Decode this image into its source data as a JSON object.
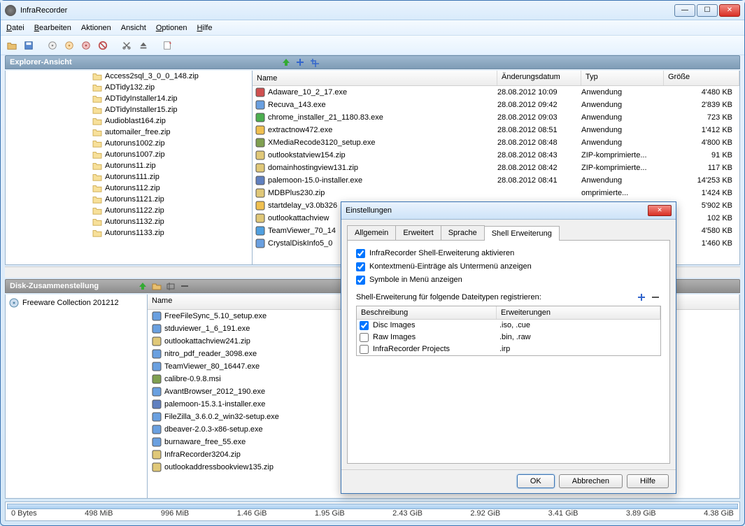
{
  "app": {
    "title": "InfraRecorder"
  },
  "menu": {
    "file": "Datei",
    "edit": "Bearbeiten",
    "actions": "Aktionen",
    "view": "Ansicht",
    "options": "Optionen",
    "help": "Hilfe"
  },
  "panes": {
    "explorer_title": "Explorer-Ansicht",
    "disk_title": "Disk-Zusammenstellung"
  },
  "tree": [
    "Access2sql_3_0_0_148.zip",
    "ADTidy132.zip",
    "ADTidyInstaller14.zip",
    "ADTidyInstaller15.zip",
    "Audioblast164.zip",
    "automailer_free.zip",
    "Autoruns1002.zip",
    "Autoruns1007.zip",
    "Autoruns11.zip",
    "Autoruns111.zip",
    "Autoruns112.zip",
    "Autoruns1121.zip",
    "Autoruns1122.zip",
    "Autoruns1132.zip",
    "Autoruns1133.zip"
  ],
  "file_cols": {
    "name": "Name",
    "date": "Änderungsdatum",
    "type": "Typ",
    "size": "Größe"
  },
  "files": [
    {
      "icon": "app-red",
      "name": "Adaware_10_2_17.exe",
      "date": "28.08.2012 10:09",
      "type": "Anwendung",
      "size": "4'480 KB"
    },
    {
      "icon": "app",
      "name": "Recuva_143.exe",
      "date": "28.08.2012 09:42",
      "type": "Anwendung",
      "size": "2'839 KB"
    },
    {
      "icon": "chrome",
      "name": "chrome_installer_21_1180.83.exe",
      "date": "28.08.2012 09:03",
      "type": "Anwendung",
      "size": "723 KB"
    },
    {
      "icon": "clock",
      "name": "extractnow472.exe",
      "date": "28.08.2012 08:51",
      "type": "Anwendung",
      "size": "1'412 KB"
    },
    {
      "icon": "installer",
      "name": "XMediaRecode3120_setup.exe",
      "date": "28.08.2012 08:48",
      "type": "Anwendung",
      "size": "4'800 KB"
    },
    {
      "icon": "zip",
      "name": "outlookstatview154.zip",
      "date": "28.08.2012 08:43",
      "type": "ZIP-komprimierte...",
      "size": "91 KB"
    },
    {
      "icon": "zip",
      "name": "domainhostingview131.zip",
      "date": "28.08.2012 08:42",
      "type": "ZIP-komprimierte...",
      "size": "117 KB"
    },
    {
      "icon": "moon",
      "name": "palemoon-15.0-installer.exe",
      "date": "28.08.2012 08:41",
      "type": "Anwendung",
      "size": "14'253 KB"
    },
    {
      "icon": "zip",
      "name": "MDBPlus230.zip",
      "date": "",
      "type": "omprimierte...",
      "size": "1'424 KB"
    },
    {
      "icon": "clock",
      "name": "startdelay_v3.0b326",
      "date": "",
      "type": "ndung",
      "size": "5'902 KB"
    },
    {
      "icon": "zip",
      "name": "outlookattachview",
      "date": "",
      "type": "omprimierte...",
      "size": "102 KB"
    },
    {
      "icon": "tv",
      "name": "TeamViewer_70_14",
      "date": "",
      "type": "ndung",
      "size": "4'580 KB"
    },
    {
      "icon": "app",
      "name": "CrystalDiskInfo5_0",
      "date": "",
      "type": "omprimierte...",
      "size": "1'460 KB"
    }
  ],
  "disk_root": "Freeware Collection 201212",
  "disk_col_name": "Name",
  "disk_files": [
    {
      "icon": "app",
      "name": "FreeFileSync_5.10_setup.exe"
    },
    {
      "icon": "app",
      "name": "stduviewer_1_6_191.exe"
    },
    {
      "icon": "zip",
      "name": "outlookattachview241.zip"
    },
    {
      "icon": "app",
      "name": "nitro_pdf_reader_3098.exe"
    },
    {
      "icon": "app",
      "name": "TeamViewer_80_16447.exe"
    },
    {
      "icon": "installer",
      "name": "calibre-0.9.8.msi"
    },
    {
      "icon": "app",
      "name": "AvantBrowser_2012_190.exe"
    },
    {
      "icon": "moon",
      "name": "palemoon-15.3.1-installer.exe"
    },
    {
      "icon": "app",
      "name": "FileZilla_3.6.0.2_win32-setup.exe"
    },
    {
      "icon": "app",
      "name": "dbeaver-2.0.3-x86-setup.exe"
    },
    {
      "icon": "app",
      "name": "burnaware_free_55.exe"
    },
    {
      "icon": "zip",
      "name": "InfraRecorder3204.zip"
    },
    {
      "icon": "zip",
      "name": "outlookaddressbookview135.zip"
    }
  ],
  "ruler": [
    "0 Bytes",
    "498 MiB",
    "996 MiB",
    "1.46 GiB",
    "1.95 GiB",
    "2.43 GiB",
    "2.92 GiB",
    "3.41 GiB",
    "3.89 GiB",
    "4.38 GiB"
  ],
  "dialog": {
    "title": "Einstellungen",
    "tabs": {
      "general": "Allgemein",
      "advanced": "Erweitert",
      "language": "Sprache",
      "shell": "Shell Erweiterung"
    },
    "chk1": "InfraRecorder Shell-Erweiterung aktivieren",
    "chk2": "Kontextmenü-Einträge als Untermenü anzeigen",
    "chk3": "Symbole in Menü anzeigen",
    "section": "Shell-Erweiterung für folgende Dateitypen registrieren:",
    "ext_head": {
      "desc": "Beschreibung",
      "ext": "Erweiterungen"
    },
    "ext_rows": [
      {
        "checked": true,
        "desc": "Disc Images",
        "ext": ".iso, .cue"
      },
      {
        "checked": false,
        "desc": "Raw Images",
        "ext": ".bin, .raw"
      },
      {
        "checked": false,
        "desc": "InfraRecorder Projects",
        "ext": ".irp"
      }
    ],
    "ok": "OK",
    "cancel": "Abbrechen",
    "help": "Hilfe"
  }
}
